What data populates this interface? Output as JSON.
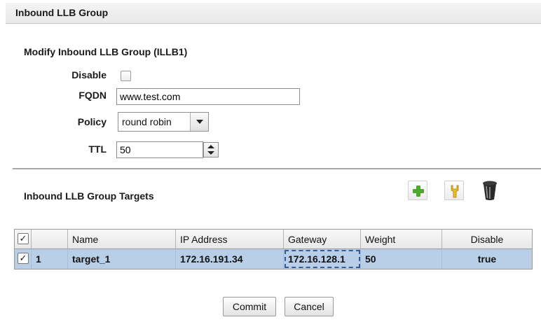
{
  "window": {
    "title": "Inbound LLB Group"
  },
  "form": {
    "heading": "Modify Inbound LLB Group (ILLB1)",
    "disable_label": "Disable",
    "disable_checked": false,
    "fqdn_label": "FQDN",
    "fqdn_value": "www.test.com",
    "policy_label": "Policy",
    "policy_value": "round robin",
    "ttl_label": "TTL",
    "ttl_value": "50"
  },
  "targets": {
    "heading": "Inbound LLB Group Targets",
    "toolbar": {
      "add_icon": "plus-icon",
      "edit_icon": "wrench-icon",
      "delete_icon": "trash-icon"
    },
    "header_check": "✓",
    "columns": [
      "Name",
      "IP Address",
      "Gateway",
      "Weight",
      "Disable"
    ],
    "rows": [
      {
        "check": "✓",
        "index": "1",
        "name": "target_1",
        "ip": "172.16.191.34",
        "gateway": "172.16.128.1",
        "weight": "50",
        "disable": "true"
      }
    ]
  },
  "actions": {
    "commit": "Commit",
    "cancel": "Cancel"
  },
  "colors": {
    "selected_row": "#b9cfe8",
    "add_green": "#4caa2a",
    "edit_yellow": "#f0c020"
  }
}
